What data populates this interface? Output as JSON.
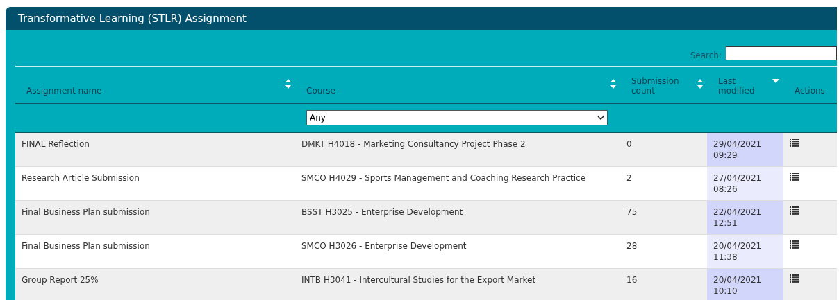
{
  "window": {
    "title": "Transformative Learning (STLR) Assignment"
  },
  "search": {
    "label": "Search:"
  },
  "table": {
    "columns": [
      {
        "label": "Assignment name",
        "sortable": true,
        "sorted": false
      },
      {
        "label": "Course",
        "sortable": true,
        "sorted": false
      },
      {
        "label": "Submission count",
        "sortable": true,
        "sorted": false
      },
      {
        "label": "Last modified",
        "sortable": true,
        "sorted": true
      },
      {
        "label": "Actions",
        "sortable": false,
        "sorted": false
      }
    ],
    "course_filter": {
      "value": "Any"
    },
    "rows": [
      {
        "name": "FINAL Reflection",
        "course": "DMKT H4018 - Marketing Consultancy Project Phase 2",
        "count": "0",
        "date": "29/04/2021",
        "time": "09:29"
      },
      {
        "name": "Research Article Submission",
        "course": "SMCO H4029 - Sports Management and Coaching Research Practice",
        "count": "2",
        "date": "27/04/2021",
        "time": "08:26"
      },
      {
        "name": "Final Business Plan submission",
        "course": "BSST H3025 - Enterprise Development",
        "count": "75",
        "date": "22/04/2021",
        "time": "12:51"
      },
      {
        "name": "Final Business Plan submission",
        "course": "SMCO H3026 - Enterprise Development",
        "count": "28",
        "date": "20/04/2021",
        "time": "11:38"
      },
      {
        "name": "Group Report 25%",
        "course": "INTB H3041 - Intercultural Studies for the Export Market",
        "count": "16",
        "date": "20/04/2021",
        "time": "10:10"
      }
    ]
  }
}
